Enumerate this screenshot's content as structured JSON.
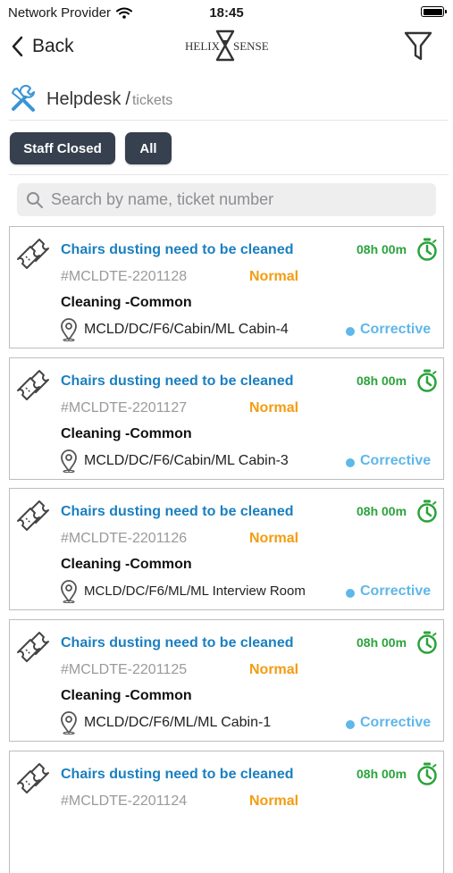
{
  "status_bar": {
    "carrier": "Network Provider",
    "time": "18:45"
  },
  "nav": {
    "back_label": "Back"
  },
  "logo": {
    "left_text": "HELIX",
    "right_text": "SENSE"
  },
  "breadcrumb": {
    "title": "Helpdesk",
    "separator": "/",
    "sub": "tickets"
  },
  "filters": [
    {
      "label": "Staff Closed"
    },
    {
      "label": "All"
    }
  ],
  "search": {
    "placeholder": "Search by name, ticket number"
  },
  "colors": {
    "title": "#1a7fc1",
    "time": "#2aa33b",
    "priority": "#f39c12",
    "type": "#5fb7ea",
    "chip": "#36404e"
  },
  "tickets": [
    {
      "title": "Chairs dusting need to be cleaned",
      "time": "08h 00m",
      "number": "#MCLDTE-2201128",
      "priority": "Normal",
      "category": "Cleaning -Common",
      "location": "MCLD/DC/F6/Cabin/ML Cabin-4",
      "type": "Corrective"
    },
    {
      "title": "Chairs dusting need to be cleaned",
      "time": "08h 00m",
      "number": "#MCLDTE-2201127",
      "priority": "Normal",
      "category": "Cleaning -Common",
      "location": "MCLD/DC/F6/Cabin/ML Cabin-3",
      "type": "Corrective"
    },
    {
      "title": "Chairs dusting need to be cleaned",
      "time": "08h 00m",
      "number": "#MCLDTE-2201126",
      "priority": "Normal",
      "category": "Cleaning -Common",
      "location": "MCLD/DC/F6/ML/ML Interview Room",
      "type": "Corrective"
    },
    {
      "title": "Chairs dusting need to be cleaned",
      "time": "08h 00m",
      "number": "#MCLDTE-2201125",
      "priority": "Normal",
      "category": "Cleaning -Common",
      "location": "MCLD/DC/F6/ML/ML Cabin-1",
      "type": "Corrective"
    },
    {
      "title": "Chairs dusting need to be cleaned",
      "time": "08h 00m",
      "number": "#MCLDTE-2201124",
      "priority": "Normal",
      "category": "",
      "location": "",
      "type": ""
    }
  ]
}
